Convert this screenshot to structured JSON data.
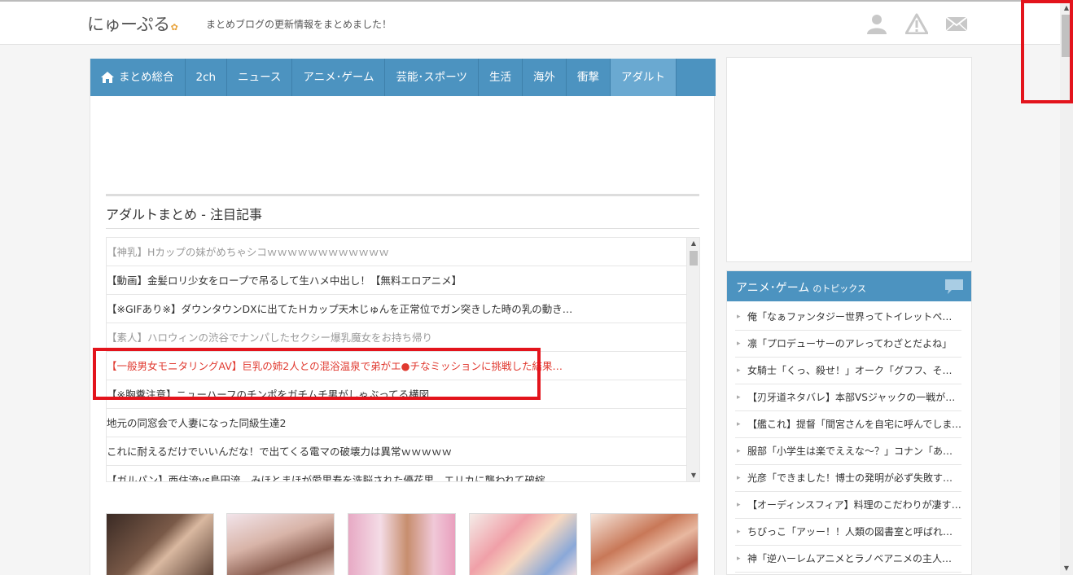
{
  "header": {
    "logo": "にゅーぷる",
    "tagline": "まとめブログの更新情報をまとめました！",
    "icons": [
      "user-icon",
      "alert-icon",
      "mail-icon"
    ]
  },
  "nav": {
    "items": [
      {
        "label": "まとめ総合",
        "icon": "home-icon"
      },
      {
        "label": "2ch"
      },
      {
        "label": "ニュース"
      },
      {
        "label": "アニメ･ゲーム"
      },
      {
        "label": "芸能･スポーツ"
      },
      {
        "label": "生活"
      },
      {
        "label": "海外"
      },
      {
        "label": "衝撃"
      },
      {
        "label": "アダルト",
        "active": true
      }
    ]
  },
  "featured": {
    "title": "アダルトまとめ - 注目記事",
    "articles": [
      {
        "text": "【神乳】Hカップの妹がめちゃシコｗｗｗｗｗｗｗｗｗｗｗｗ",
        "state": "visited"
      },
      {
        "text": "【動画】金髪ロリ少女をロープで吊るして生ハメ中出し！【無料エロアニメ】",
        "state": "normal"
      },
      {
        "text": "【※GIFあり※】ダウンタウンDXに出てたＨカップ天木じゅんを正常位でガン突きした時の乳の動き…",
        "state": "normal"
      },
      {
        "text": "【素人】ハロウィンの渋谷でナンパしたセクシー爆乳魔女をお持ち帰り",
        "state": "visited"
      },
      {
        "text": "【一般男女モニタリングAV】巨乳の姉2人との混浴温泉で弟がエ●チなミッションに挑戦した結果…",
        "state": "red"
      },
      {
        "text": "【※胸糞注意】ニューハーフのチンポをガチムチ男がしゃぶってる構図",
        "state": "normal"
      },
      {
        "text": "地元の同窓会で人妻になった同級生達2",
        "state": "normal"
      },
      {
        "text": "これに耐えるだけでいいんだな！で出てくる電マの破壊力は異常ｗｗｗｗｗ",
        "state": "normal"
      },
      {
        "text": "【ガルパン】西住流vs島田流　みほとまほが愛里寿を洗脳された優花里、エリカに襲われて破綻",
        "state": "normal"
      }
    ]
  },
  "sidebar": {
    "topics_title": "アニメ･ゲーム",
    "topics_suffix": "のトピックス",
    "topics": [
      "俺「なぁファンタジー世界ってトイレットペーパー無…",
      "凛「プロデューサーのアレってわざとだよね」",
      "女騎士「くっ、殺せ！」オーク「グフフ、そうはいかん」",
      "【刃牙道ネタバレ】本部VSジャックの一戦が衝撃…",
      "【艦これ】提督「間宮さんを自宅に呼んでしまった…",
      "服部「小学生は楽でええな～？」コナン「ああ！？」",
      "光彦「できました！博士の発明が必ず失敗するス…",
      "【オーディンスフィア】料理のこだわりが凄すぎ！ほ…",
      "ちびっこ「アッー！！人類の図書室と呼ばれる圧…",
      "神「逆ハーレムアニメとラノベアニメの主人公を入…"
    ]
  },
  "colors": {
    "accent": "#4c93c0",
    "accent_active": "#6aa9d1",
    "annotation": "#e3141c",
    "link_red": "#e0392f"
  }
}
